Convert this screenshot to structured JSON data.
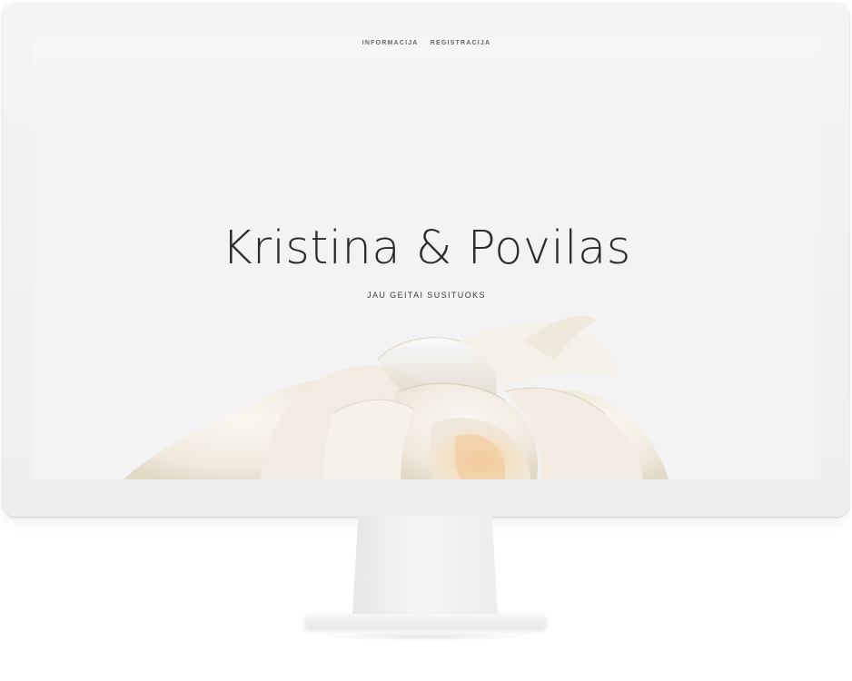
{
  "nav": {
    "items": [
      {
        "label": "INFORMACIJA"
      },
      {
        "label": "REGISTRACIJA"
      }
    ]
  },
  "hero": {
    "title": "Kristina & Povilas",
    "subtitle": "JAU GEITAI SUSITUOKS"
  },
  "colors": {
    "screen_bg": "#f3f3f3",
    "text": "#2a2a2a",
    "rose_petal": "#f4efe6",
    "rose_center": "#f3d9b8"
  },
  "icons": {
    "hero_image": "white-rose"
  }
}
